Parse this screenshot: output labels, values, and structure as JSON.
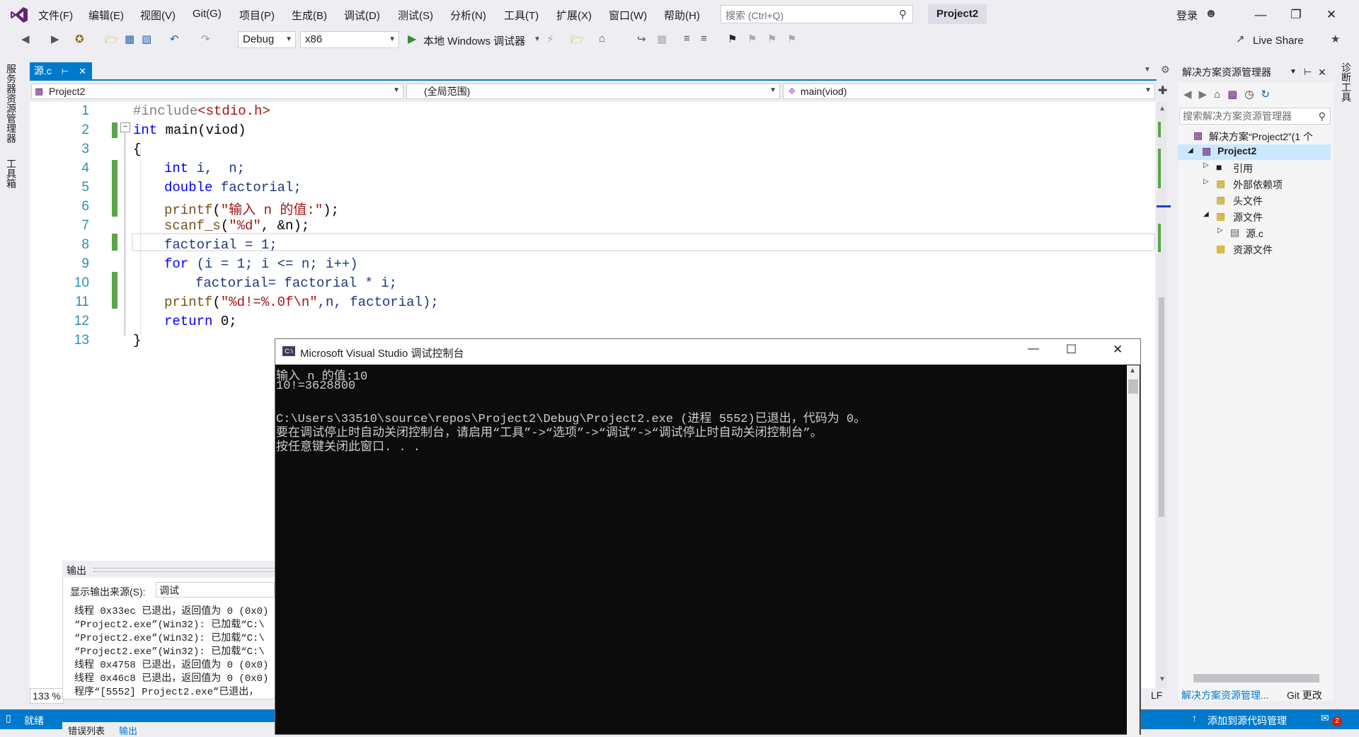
{
  "menu": {
    "items": [
      "文件(F)",
      "编辑(E)",
      "视图(V)",
      "Git(G)",
      "项目(P)",
      "生成(B)",
      "调试(D)",
      "测试(S)",
      "分析(N)",
      "工具(T)",
      "扩展(X)",
      "窗口(W)",
      "帮助(H)"
    ],
    "search_placeholder": "搜索 (Ctrl+Q)",
    "project_title": "Project2",
    "login": "登录"
  },
  "toolbar": {
    "config": "Debug",
    "platform": "x86",
    "run_label": "本地 Windows 调试器",
    "live_share": "Live Share"
  },
  "side_tabs": {
    "server_explorer": "服务器资源管理器",
    "toolbox": "工具箱",
    "diagnostics": "诊断工具"
  },
  "editor": {
    "tab_label": "源.c",
    "nav_project": "Project2",
    "nav_scope": "(全局范围)",
    "nav_function": "main(viod)",
    "zoom": "133 %",
    "line_ending": "LF",
    "line_numbers": [
      "1",
      "2",
      "3",
      "4",
      "5",
      "6",
      "7",
      "8",
      "9",
      "10",
      "11",
      "12",
      "13"
    ]
  },
  "code": {
    "l1_pp": "#include",
    "l1_hdr": "<stdio.h>",
    "l2_kw": "int",
    "l2_rest": " main(viod)",
    "l3": "{",
    "l4_kw": "int",
    "l4_rest": " i,  n;",
    "l5_kw": "double",
    "l5_rest": " factorial;",
    "l6_fn": "printf",
    "l6_open": "(",
    "l6_str": "\"输入 n 的值:\"",
    "l6_close": ");",
    "l7_fn": "scanf_s",
    "l7_open": "(",
    "l7_str": "\"%d\"",
    "l7_rest": ", &n);",
    "l8": "factorial = 1;",
    "l9_kw": "for",
    "l9_rest": " (i = 1; i <= n; i++)",
    "l10": "factorial= factorial * i;",
    "l11_fn": "printf",
    "l11_open": "(",
    "l11_str": "\"%d!=%.0f\\n\"",
    "l11_rest": ",n, factorial);",
    "l12_kw": "return",
    "l12_rest": " 0;",
    "l13": "}"
  },
  "output": {
    "title": "输出",
    "source_label": "显示输出来源(S):",
    "source_value": "调试",
    "lines": [
      "线程 0x33ec 已退出，返回值为 0 (0x0)",
      "“Project2.exe”(Win32): 已加载“C:\\",
      "“Project2.exe”(Win32): 已加载“C:\\",
      "“Project2.exe”(Win32): 已加载“C:\\",
      "线程 0x4758 已退出，返回值为 0 (0x0)",
      "线程 0x46c8 已退出，返回值为 0 (0x0)",
      "程序“[5552] Project2.exe”已退出，"
    ],
    "bottom_tabs": [
      "错误列表",
      "输出"
    ]
  },
  "console": {
    "title": "Microsoft Visual Studio 调试控制台",
    "lines": [
      "输入 n 的值:10",
      "10!=3628800",
      "",
      "C:\\Users\\33510\\source\\repos\\Project2\\Debug\\Project2.exe (进程 5552)已退出，代码为 0。",
      "要在调试停止时自动关闭控制台，请启用“工具”->“选项”->“调试”->“调试停止时自动关闭控制台”。",
      "按任意键关闭此窗口. . ."
    ]
  },
  "solution_explorer": {
    "title": "解决方案资源管理器",
    "search_placeholder": "搜索解决方案资源管理器",
    "solution": "解决方案“Project2”(1 个",
    "project": "Project2",
    "references": "引用",
    "external_deps": "外部依赖项",
    "headers": "头文件",
    "sources": "源文件",
    "source_file": "源.c",
    "resources": "资源文件",
    "bottom_tab_1": "解决方案资源管理...",
    "bottom_tab_2": "Git 更改"
  },
  "status": {
    "ready": "就绪",
    "add_source_control": "添加到源代码管理",
    "notifications": "2"
  },
  "colors": {
    "accent": "#007acc",
    "keyword": "#0000ff",
    "string": "#a31515",
    "line_number": "#2b91af",
    "change_bar": "#57a64a"
  }
}
